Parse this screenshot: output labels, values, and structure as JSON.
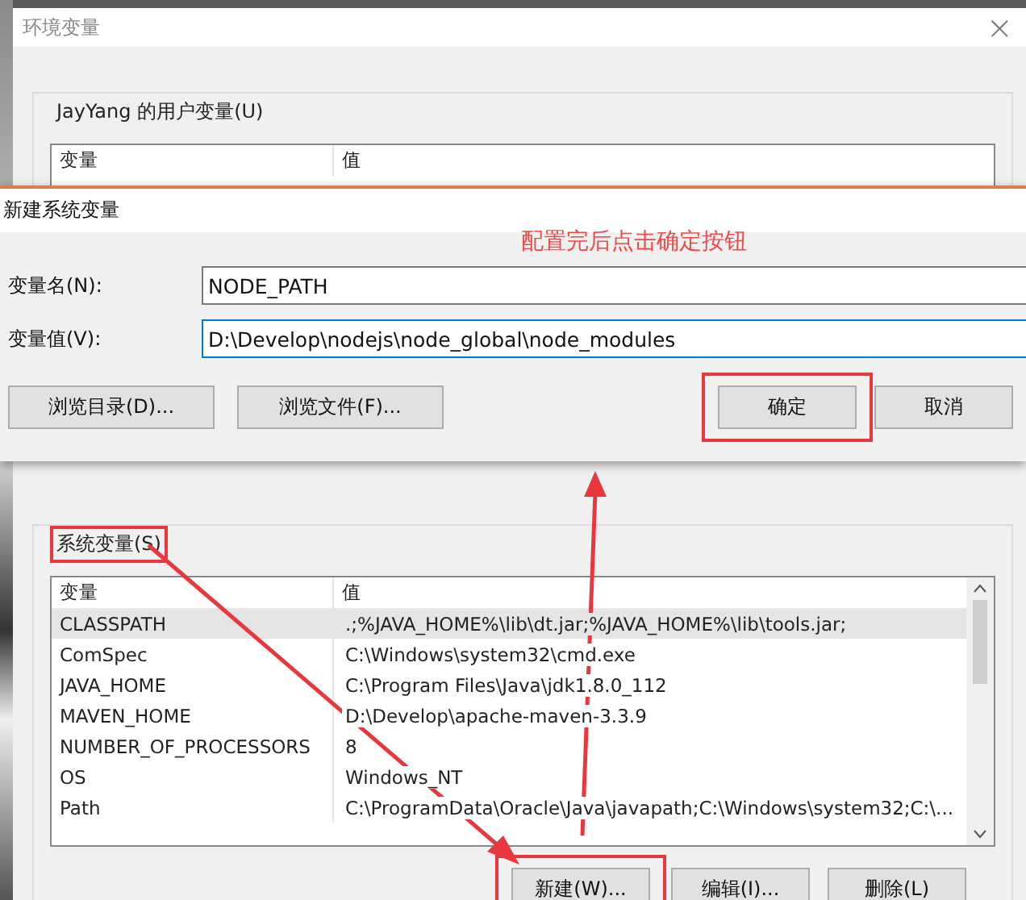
{
  "window": {
    "title": "环境变量",
    "close": "×"
  },
  "user_vars": {
    "label": "JayYang 的用户变量(U)",
    "columns": [
      "变量",
      "值"
    ]
  },
  "dialog": {
    "title": "新建系统变量",
    "annotation": "配置完后点击确定按钮",
    "fields": [
      {
        "label": "变量名(N):",
        "value": "NODE_PATH",
        "focused": false
      },
      {
        "label": "变量值(V):",
        "value": "D:\\Develop\\nodejs\\node_global\\node_modules",
        "focused": true
      }
    ],
    "buttons": [
      {
        "label": "浏览目录(D)...",
        "highlighted": false
      },
      {
        "label": "浏览文件(F)...",
        "highlighted": false
      },
      {
        "label": "确定",
        "highlighted": true
      },
      {
        "label": "取消",
        "highlighted": false
      }
    ]
  },
  "system_vars": {
    "label": "系统变量(S)",
    "highlighted": true,
    "columns": [
      "变量",
      "值"
    ],
    "rows": [
      {
        "name": "CLASSPATH",
        "value": ".;%JAVA_HOME%\\lib\\dt.jar;%JAVA_HOME%\\lib\\tools.jar;",
        "selected": true
      },
      {
        "name": "ComSpec",
        "value": "C:\\Windows\\system32\\cmd.exe",
        "selected": false
      },
      {
        "name": "JAVA_HOME",
        "value": "C:\\Program Files\\Java\\jdk1.8.0_112",
        "selected": false
      },
      {
        "name": "MAVEN_HOME",
        "value": "D:\\Develop\\apache-maven-3.3.9",
        "selected": false
      },
      {
        "name": "NUMBER_OF_PROCESSORS",
        "value": "8",
        "selected": false
      },
      {
        "name": "OS",
        "value": "Windows_NT",
        "selected": false
      },
      {
        "name": "Path",
        "value": "C:\\ProgramData\\Oracle\\Java\\javapath;C:\\Windows\\system32;C:\\...",
        "selected": false
      }
    ],
    "buttons": [
      {
        "label": "新建(W)...",
        "highlighted": true
      },
      {
        "label": "编辑(I)...",
        "highlighted": false
      },
      {
        "label": "删除(L)",
        "highlighted": false
      }
    ]
  }
}
